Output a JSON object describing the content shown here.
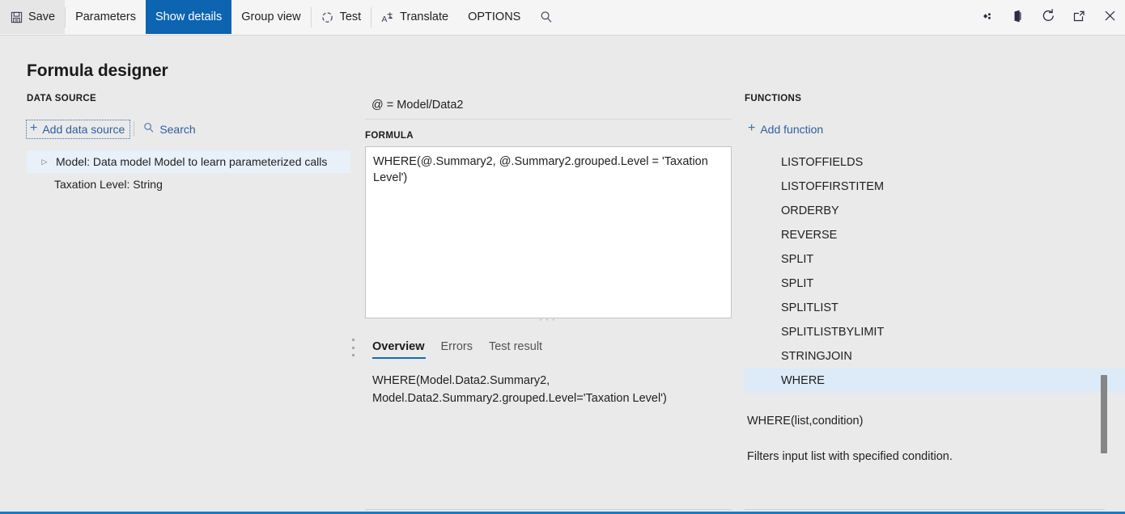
{
  "commandbar": {
    "items": [
      {
        "label": "Save",
        "icon": "save-icon",
        "selected": false
      },
      {
        "label": "Parameters",
        "icon": "",
        "selected": false
      },
      {
        "label": "Show details",
        "icon": "",
        "selected": true
      },
      {
        "label": "Group view",
        "icon": "",
        "selected": false
      },
      {
        "label": "Test",
        "icon": "progress-circle-icon",
        "selected": false
      },
      {
        "label": "Translate",
        "icon": "translate-icon",
        "selected": false
      },
      {
        "label": "OPTIONS",
        "icon": "",
        "selected": false
      }
    ],
    "search_icon": "search-icon",
    "right_icons": [
      "diamond-settings-icon",
      "office-app-icon",
      "refresh-icon",
      "popout-icon",
      "close-icon"
    ]
  },
  "page": {
    "title": "Formula designer"
  },
  "data_source": {
    "section_label": "DATA SOURCE",
    "add_label": "Add data source",
    "search_label": "Search",
    "tree": [
      {
        "label": "Model: Data model Model to learn parameterized calls",
        "expandable": true,
        "selected": true,
        "level": 0
      },
      {
        "label": "Taxation Level: String",
        "expandable": false,
        "selected": false,
        "level": 1
      }
    ]
  },
  "center": {
    "context_line": "@ = Model/Data2",
    "formula_label": "FORMULA",
    "formula_value": "WHERE(@.Summary2, @.Summary2.grouped.Level = 'Taxation Level')",
    "formula_placeholder": "",
    "tabs": [
      {
        "label": "Overview",
        "active": true
      },
      {
        "label": "Errors",
        "active": false
      },
      {
        "label": "Test result",
        "active": false
      }
    ],
    "overview_text": "WHERE(Model.Data2.Summary2,\nModel.Data2.Summary2.grouped.Level='Taxation Level')"
  },
  "functions": {
    "section_label": "FUNCTIONS",
    "add_label": "Add function",
    "items": [
      {
        "name": "LISTOFFIELDS",
        "selected": false
      },
      {
        "name": "LISTOFFIRSTITEM",
        "selected": false
      },
      {
        "name": "ORDERBY",
        "selected": false
      },
      {
        "name": "REVERSE",
        "selected": false
      },
      {
        "name": "SPLIT",
        "selected": false
      },
      {
        "name": "SPLIT",
        "selected": false
      },
      {
        "name": "SPLITLIST",
        "selected": false
      },
      {
        "name": "SPLITLISTBYLIMIT",
        "selected": false
      },
      {
        "name": "STRINGJOIN",
        "selected": false
      },
      {
        "name": "WHERE",
        "selected": true
      }
    ],
    "signature": "WHERE(list,condition)",
    "description": "Filters input list with specified condition."
  },
  "colors": {
    "accent": "#0d64b0",
    "tab_underline": "#0f6cbd",
    "link": "#2c5f9e",
    "selection_light": "#ddeaf7",
    "tree_selection": "#e8f0fa",
    "page_bg": "#eaeaea",
    "cmdbar_bg": "#f5f5f5",
    "bottom_border": "#1a7cc0"
  }
}
